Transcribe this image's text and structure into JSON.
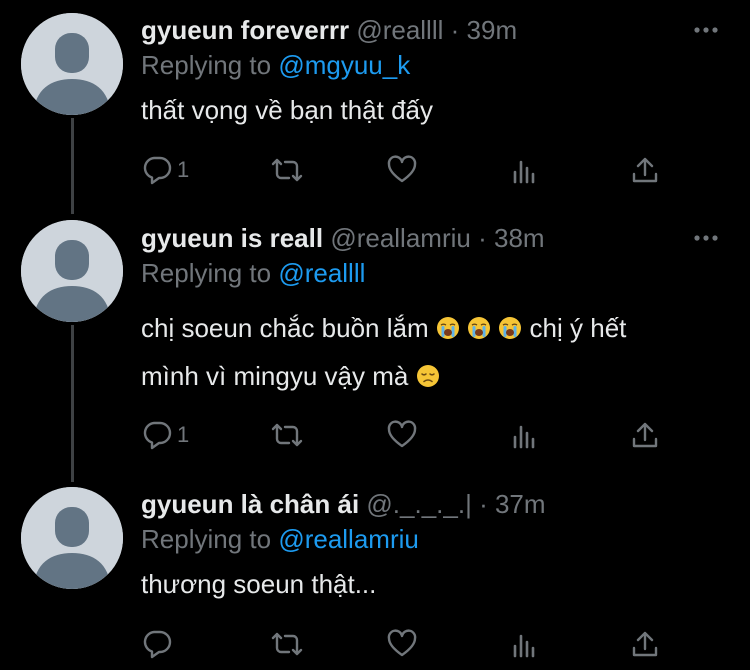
{
  "tweets": [
    {
      "name": "gyueun foreverrr",
      "handle": "@reallll",
      "separator": "·",
      "time": "39m",
      "replying_prefix": "Replying to ",
      "replying_to": "@mgyuu_k",
      "text_lines": [
        "thất vọng về bạn thật đấy"
      ],
      "reply_count": "1"
    },
    {
      "name": "gyueun is reall",
      "handle": "@reallamriu",
      "separator": "·",
      "time": "38m",
      "replying_prefix": "Replying to ",
      "replying_to": "@reallll",
      "text_segments": {
        "line1_a": "chị soeun chắc buồn lắm ",
        "line1_b": " chị ý hết",
        "line2_a": "mình vì mingyu vậy mà "
      },
      "emojis": [
        "crying-face-emoji",
        "crying-face-emoji",
        "crying-face-emoji",
        "disappointed-face-emoji"
      ],
      "reply_count": "1"
    },
    {
      "name": "gyueun là chân ái",
      "handle": "@._._._.|",
      "separator": "·",
      "time": "37m",
      "replying_prefix": "Replying to ",
      "replying_to": "@reallamriu",
      "text_lines": [
        "thương soeun thật..."
      ],
      "reply_count": ""
    }
  ],
  "icons": [
    "reply-icon",
    "retweet-icon",
    "like-icon",
    "analytics-icon",
    "share-icon",
    "more-icon"
  ],
  "colors": {
    "background": "#000000",
    "text": "#e7e9ea",
    "secondary": "#71767b",
    "mention": "#1d9bf0",
    "thread_line": "#3e4144"
  }
}
